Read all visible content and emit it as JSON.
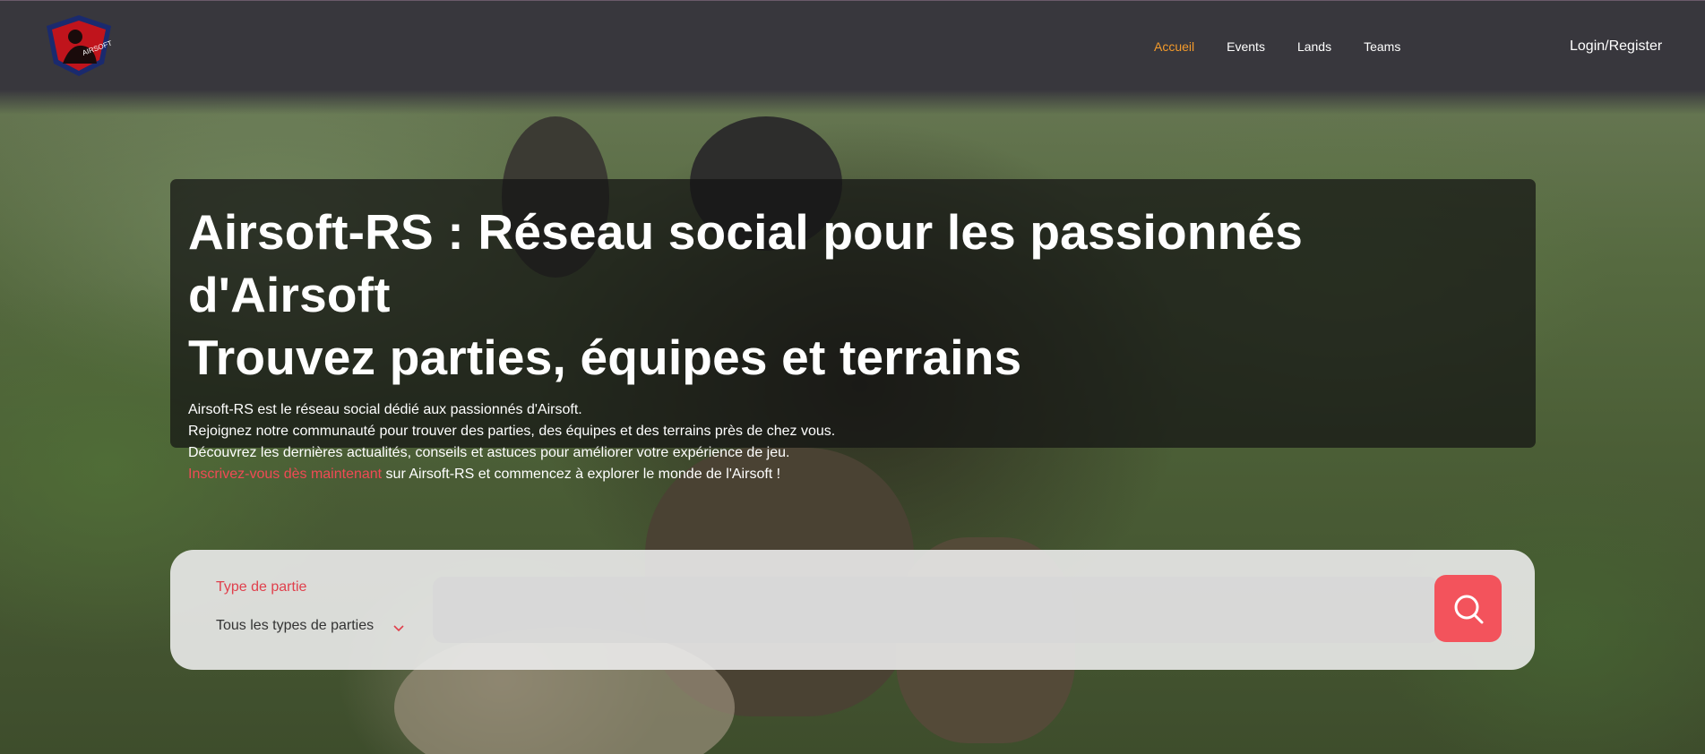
{
  "header": {
    "logo_text": "AIRSOFT",
    "nav": [
      {
        "label": "Accueil",
        "active": true
      },
      {
        "label": "Events",
        "active": false
      },
      {
        "label": "Lands",
        "active": false
      },
      {
        "label": "Teams",
        "active": false
      }
    ],
    "login_label": "Login/Register"
  },
  "intro": {
    "title_line1": "Airsoft-RS : Réseau social pour les passionnés d'Airsoft",
    "title_line2": "Trouvez parties, équipes et terrains",
    "line1": "Airsoft-RS est le réseau social dédié aux passionnés d'Airsoft.",
    "line2": "Rejoignez notre communauté pour trouver des parties, des équipes et des terrains près de chez vous.",
    "line3": "Découvrez les dernières actualités, conseils et astuces pour améliorer votre expérience de jeu.",
    "line4_link": "Inscrivez-vous dès maintenant",
    "line4_rest": " sur Airsoft-RS et commencez à explorer le monde de l'Airsoft !"
  },
  "search": {
    "type_label": "Type de partie",
    "type_value": "Tous les types de parties",
    "query_value": ""
  },
  "colors": {
    "header_bg": "#38373d",
    "nav_active": "#f39a2b",
    "accent_red": "#f04a55",
    "search_button": "#f3535c"
  },
  "icons": {
    "logo": "airsoft-shield-logo",
    "dropdown": "chevron-down-icon",
    "search": "search-icon"
  }
}
